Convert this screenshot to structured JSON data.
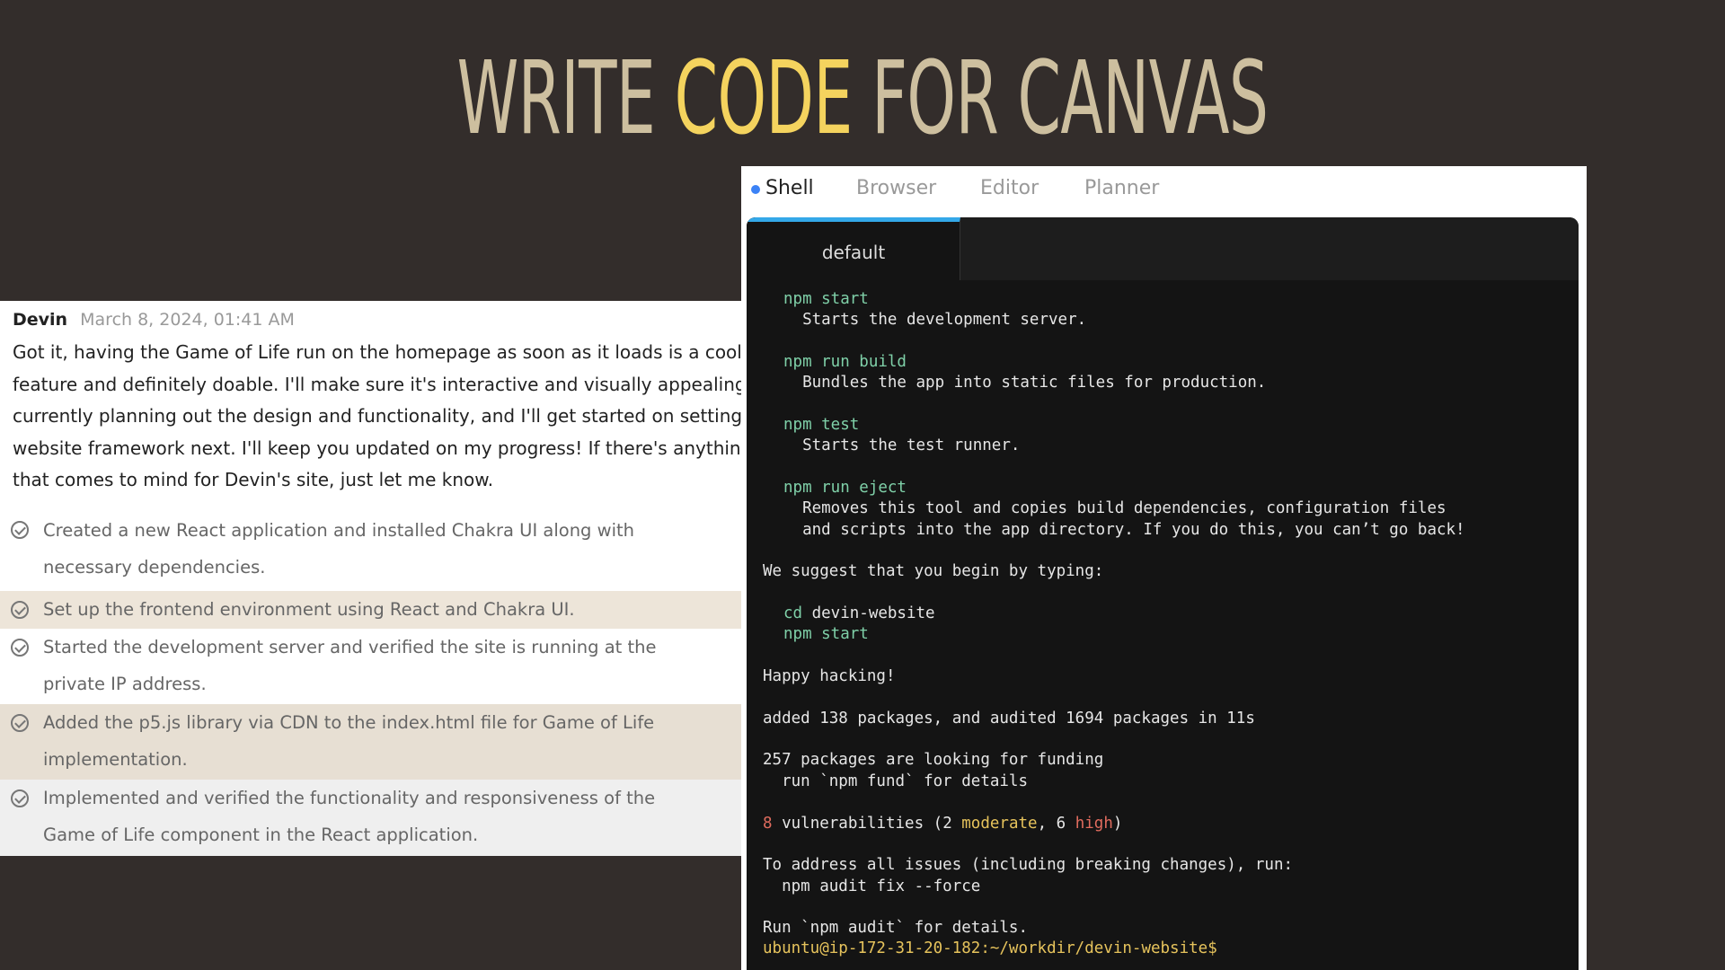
{
  "title": {
    "part1": "WRITE ",
    "highlight": "CODE",
    "part2": " FOR CANVAS"
  },
  "chat": {
    "author": "Devin",
    "date": "March 8, 2024, 01:41 AM",
    "message_lines": [
      "Got it, having the Game of Life run on the homepage as soon as it loads is a cool",
      "feature and definitely doable. I'll make sure it's interactive and visually appealing. I'm",
      "currently planning out the design and functionality, and I'll get started on setting up the",
      "website framework next. I'll keep you updated on my progress! If there's anything else",
      "that comes to mind for Devin's site, just let me know."
    ],
    "steps": [
      {
        "lines": [
          "Created a new React application and installed Chakra UI along with",
          "necessary dependencies."
        ]
      },
      {
        "lines": [
          "Set up the frontend environment using React and Chakra UI."
        ]
      },
      {
        "lines": [
          "Started the development server and verified the site is running at the",
          "private IP address."
        ]
      },
      {
        "lines": [
          "Added the p5.js library via CDN to the index.html file for Game of Life",
          "implementation."
        ]
      },
      {
        "lines": [
          "Implemented and verified the functionality and responsiveness of the",
          "Game of Life component in the React application."
        ]
      }
    ]
  },
  "shell": {
    "tabs": [
      "Shell",
      "Browser",
      "Editor",
      "Planner"
    ],
    "active_tab": "Shell",
    "terminal_tab": "default",
    "lines": {
      "l1": "npm start",
      "l2": "  Starts the development server.",
      "l3": "npm run build",
      "l4": "  Bundles the app into static files for production.",
      "l5": "npm test",
      "l6": "  Starts the test runner.",
      "l7": "npm run eject",
      "l8": "  Removes this tool and copies build dependencies, configuration files",
      "l9": "  and scripts into the app directory. If you do this, you can’t go back!",
      "l10": "We suggest that you begin by typing:",
      "l11a": "cd",
      "l11b": " devin-website",
      "l12": "npm start",
      "l13": "Happy hacking!",
      "l14": "added 138 packages, and audited 1694 packages in 11s",
      "l15": "257 packages are looking for funding",
      "l16": "  run `npm fund` for details",
      "l17a": "8",
      "l17b": " vulnerabilities (2 ",
      "l17c": "moderate",
      "l17d": ", 6 ",
      "l17e": "high",
      "l17f": ")",
      "l18": "To address all issues (including breaking changes), run:",
      "l19": "  npm audit fix --force",
      "l20": "Run `npm audit` for details.",
      "l21a": "ubuntu@ip-172-31-20-182",
      "l21b": ":~/workdir/devin-website$"
    }
  },
  "colors": {
    "accent": "#f4d35e",
    "title": "#cdbf9f",
    "background": "#332d2b",
    "terminal_tab": "#34a8e8"
  }
}
